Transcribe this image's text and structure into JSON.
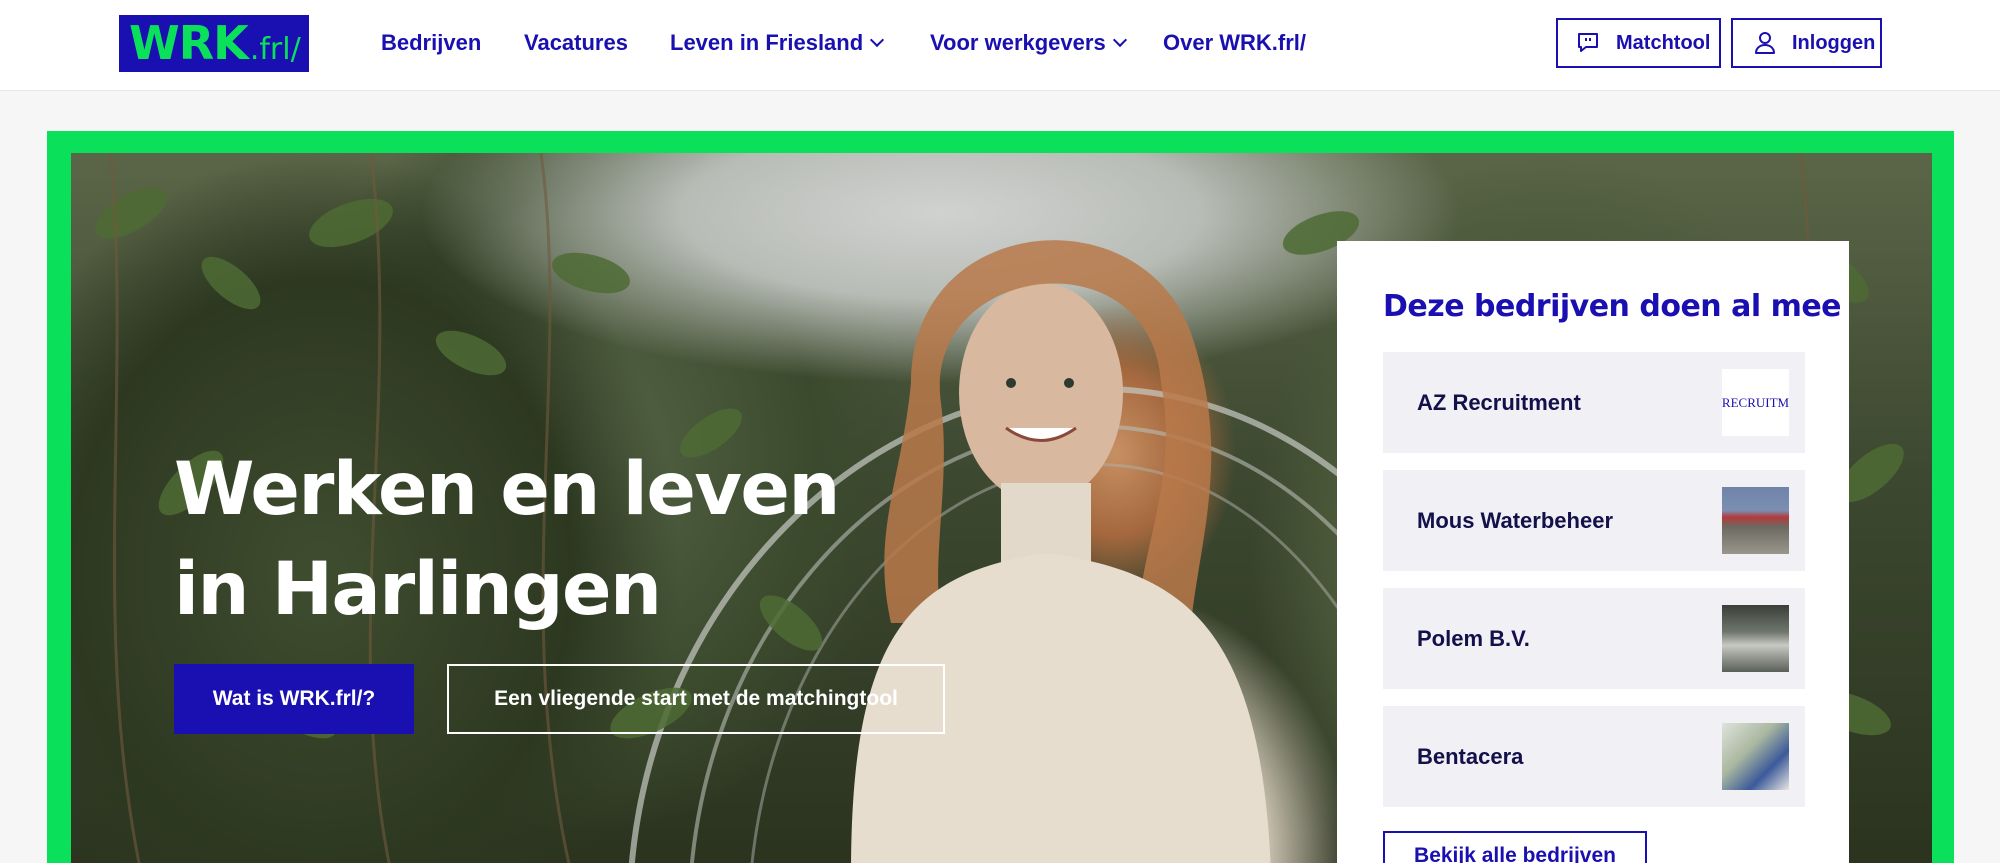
{
  "header": {
    "logo": {
      "main": "WRK",
      "suffix": ".frl/"
    },
    "nav": [
      {
        "label": "Bedrijven",
        "dropdown": false
      },
      {
        "label": "Vacatures",
        "dropdown": false
      },
      {
        "label": "Leven in Friesland",
        "dropdown": true
      },
      {
        "label": "Voor werkgevers",
        "dropdown": true
      },
      {
        "label": "Over WRK.frl/",
        "dropdown": false
      }
    ],
    "matchtool_label": "Matchtool",
    "login_label": "Inloggen"
  },
  "hero": {
    "title_line1": "Werken en leven",
    "title_line2": "in Harlingen",
    "primary_button": "Wat is WRK.frl/?",
    "secondary_button": "Een vliegende start met de matchingtool"
  },
  "companies": {
    "title": "Deze bedrijven doen al mee",
    "items": [
      {
        "name": "AZ Recruitment",
        "logo_text": "RECRUITM"
      },
      {
        "name": "Mous Waterbeheer"
      },
      {
        "name": "Polem B.V."
      },
      {
        "name": "Bentacera"
      }
    ],
    "all_button": "Bekijk alle bedrijven"
  },
  "colors": {
    "brand_blue": "#1a0fb0",
    "brand_green": "#0be05b",
    "card_item_bg": "#f0f0f5"
  }
}
